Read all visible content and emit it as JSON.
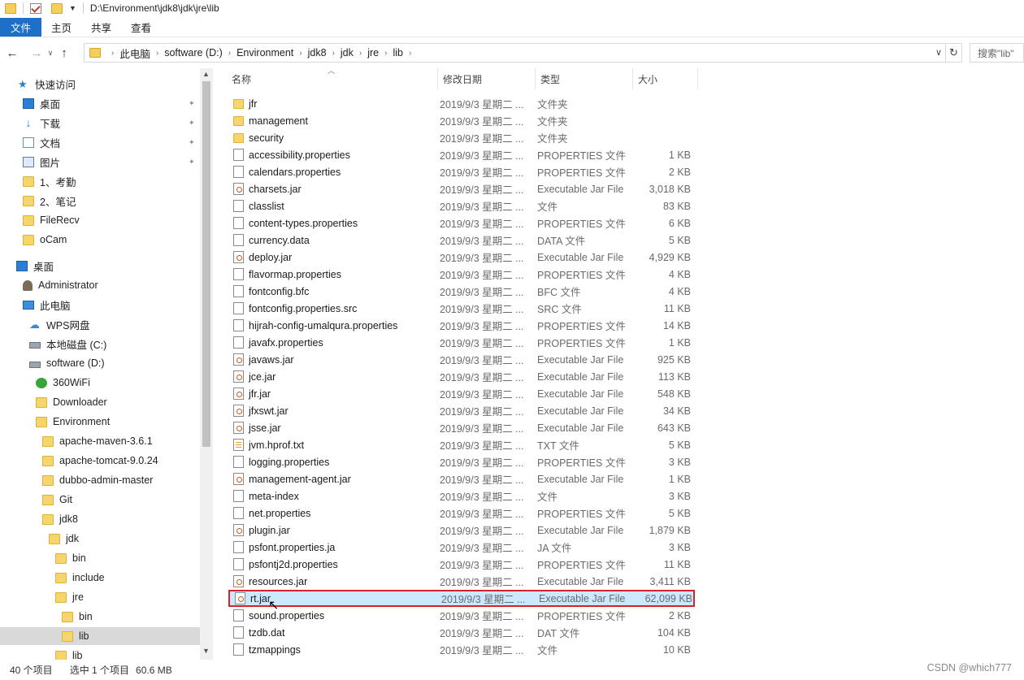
{
  "window": {
    "title": "D:\\Environment\\jdk8\\jdk\\jre\\lib"
  },
  "ribbon": {
    "tabs": [
      "文件",
      "主页",
      "共享",
      "查看"
    ]
  },
  "address": {
    "crumbs": [
      "此电脑",
      "software (D:)",
      "Environment",
      "jdk8",
      "jdk",
      "jre",
      "lib"
    ],
    "search_placeholder": "搜索\"lib\""
  },
  "nav": {
    "items": [
      {
        "label": "快速访问",
        "icon": "star-icon"
      },
      {
        "label": "桌面",
        "icon": "desktop-icon",
        "pinned": true
      },
      {
        "label": "下载",
        "icon": "download-icon",
        "pinned": true
      },
      {
        "label": "文档",
        "icon": "document-icon",
        "pinned": true
      },
      {
        "label": "图片",
        "icon": "picture-icon",
        "pinned": true
      },
      {
        "label": "1、考勤",
        "icon": "folder-icon"
      },
      {
        "label": "2、笔记",
        "icon": "folder-icon"
      },
      {
        "label": "FileRecv",
        "icon": "folder-icon"
      },
      {
        "label": "oCam",
        "icon": "folder-icon"
      },
      {
        "label": "桌面",
        "icon": "desktop-icon"
      },
      {
        "label": "Administrator",
        "icon": "user-icon"
      },
      {
        "label": "此电脑",
        "icon": "computer-icon"
      },
      {
        "label": "WPS网盘",
        "icon": "cloud-icon"
      },
      {
        "label": "本地磁盘 (C:)",
        "icon": "drive-icon"
      },
      {
        "label": "software (D:)",
        "icon": "drive-icon"
      },
      {
        "label": "360WiFi",
        "icon": "wifi-icon"
      },
      {
        "label": "Downloader",
        "icon": "folder-icon"
      },
      {
        "label": "Environment",
        "icon": "folder-icon"
      },
      {
        "label": "apache-maven-3.6.1",
        "icon": "folder-icon"
      },
      {
        "label": "apache-tomcat-9.0.24",
        "icon": "folder-icon"
      },
      {
        "label": "dubbo-admin-master",
        "icon": "folder-icon"
      },
      {
        "label": "Git",
        "icon": "folder-icon"
      },
      {
        "label": "jdk8",
        "icon": "folder-icon"
      },
      {
        "label": "jdk",
        "icon": "folder-icon"
      },
      {
        "label": "bin",
        "icon": "folder-icon"
      },
      {
        "label": "include",
        "icon": "folder-icon"
      },
      {
        "label": "jre",
        "icon": "folder-icon"
      },
      {
        "label": "bin",
        "icon": "folder-icon"
      },
      {
        "label": "lib",
        "icon": "folder-icon",
        "selected": true
      },
      {
        "label": "lib",
        "icon": "folder-icon"
      }
    ]
  },
  "columns": {
    "name": "名称",
    "date": "修改日期",
    "type": "类型",
    "size": "大小"
  },
  "files": [
    {
      "name": "jfr",
      "date": "2019/9/3 星期二 ...",
      "type": "文件夹",
      "size": "",
      "icon": "folder"
    },
    {
      "name": "management",
      "date": "2019/9/3 星期二 ...",
      "type": "文件夹",
      "size": "",
      "icon": "folder"
    },
    {
      "name": "security",
      "date": "2019/9/3 星期二 ...",
      "type": "文件夹",
      "size": "",
      "icon": "folder"
    },
    {
      "name": "accessibility.properties",
      "date": "2019/9/3 星期二 ...",
      "type": "PROPERTIES 文件",
      "size": "1 KB",
      "icon": "file"
    },
    {
      "name": "calendars.properties",
      "date": "2019/9/3 星期二 ...",
      "type": "PROPERTIES 文件",
      "size": "2 KB",
      "icon": "file"
    },
    {
      "name": "charsets.jar",
      "date": "2019/9/3 星期二 ...",
      "type": "Executable Jar File",
      "size": "3,018 KB",
      "icon": "jar"
    },
    {
      "name": "classlist",
      "date": "2019/9/3 星期二 ...",
      "type": "文件",
      "size": "83 KB",
      "icon": "file"
    },
    {
      "name": "content-types.properties",
      "date": "2019/9/3 星期二 ...",
      "type": "PROPERTIES 文件",
      "size": "6 KB",
      "icon": "file"
    },
    {
      "name": "currency.data",
      "date": "2019/9/3 星期二 ...",
      "type": "DATA 文件",
      "size": "5 KB",
      "icon": "file"
    },
    {
      "name": "deploy.jar",
      "date": "2019/9/3 星期二 ...",
      "type": "Executable Jar File",
      "size": "4,929 KB",
      "icon": "jar"
    },
    {
      "name": "flavormap.properties",
      "date": "2019/9/3 星期二 ...",
      "type": "PROPERTIES 文件",
      "size": "4 KB",
      "icon": "file"
    },
    {
      "name": "fontconfig.bfc",
      "date": "2019/9/3 星期二 ...",
      "type": "BFC 文件",
      "size": "4 KB",
      "icon": "file"
    },
    {
      "name": "fontconfig.properties.src",
      "date": "2019/9/3 星期二 ...",
      "type": "SRC 文件",
      "size": "11 KB",
      "icon": "file"
    },
    {
      "name": "hijrah-config-umalqura.properties",
      "date": "2019/9/3 星期二 ...",
      "type": "PROPERTIES 文件",
      "size": "14 KB",
      "icon": "file"
    },
    {
      "name": "javafx.properties",
      "date": "2019/9/3 星期二 ...",
      "type": "PROPERTIES 文件",
      "size": "1 KB",
      "icon": "file"
    },
    {
      "name": "javaws.jar",
      "date": "2019/9/3 星期二 ...",
      "type": "Executable Jar File",
      "size": "925 KB",
      "icon": "jar"
    },
    {
      "name": "jce.jar",
      "date": "2019/9/3 星期二 ...",
      "type": "Executable Jar File",
      "size": "113 KB",
      "icon": "jar"
    },
    {
      "name": "jfr.jar",
      "date": "2019/9/3 星期二 ...",
      "type": "Executable Jar File",
      "size": "548 KB",
      "icon": "jar"
    },
    {
      "name": "jfxswt.jar",
      "date": "2019/9/3 星期二 ...",
      "type": "Executable Jar File",
      "size": "34 KB",
      "icon": "jar"
    },
    {
      "name": "jsse.jar",
      "date": "2019/9/3 星期二 ...",
      "type": "Executable Jar File",
      "size": "643 KB",
      "icon": "jar"
    },
    {
      "name": "jvm.hprof.txt",
      "date": "2019/9/3 星期二 ...",
      "type": "TXT 文件",
      "size": "5 KB",
      "icon": "txt"
    },
    {
      "name": "logging.properties",
      "date": "2019/9/3 星期二 ...",
      "type": "PROPERTIES 文件",
      "size": "3 KB",
      "icon": "file"
    },
    {
      "name": "management-agent.jar",
      "date": "2019/9/3 星期二 ...",
      "type": "Executable Jar File",
      "size": "1 KB",
      "icon": "jar"
    },
    {
      "name": "meta-index",
      "date": "2019/9/3 星期二 ...",
      "type": "文件",
      "size": "3 KB",
      "icon": "file"
    },
    {
      "name": "net.properties",
      "date": "2019/9/3 星期二 ...",
      "type": "PROPERTIES 文件",
      "size": "5 KB",
      "icon": "file"
    },
    {
      "name": "plugin.jar",
      "date": "2019/9/3 星期二 ...",
      "type": "Executable Jar File",
      "size": "1,879 KB",
      "icon": "jar"
    },
    {
      "name": "psfont.properties.ja",
      "date": "2019/9/3 星期二 ...",
      "type": "JA 文件",
      "size": "3 KB",
      "icon": "file"
    },
    {
      "name": "psfontj2d.properties",
      "date": "2019/9/3 星期二 ...",
      "type": "PROPERTIES 文件",
      "size": "11 KB",
      "icon": "file"
    },
    {
      "name": "resources.jar",
      "date": "2019/9/3 星期二 ...",
      "type": "Executable Jar File",
      "size": "3,411 KB",
      "icon": "jar"
    },
    {
      "name": "rt.jar",
      "date": "2019/9/3 星期二 ...",
      "type": "Executable Jar File",
      "size": "62,099 KB",
      "icon": "jar",
      "selected": true
    },
    {
      "name": "sound.properties",
      "date": "2019/9/3 星期二 ...",
      "type": "PROPERTIES 文件",
      "size": "2 KB",
      "icon": "file"
    },
    {
      "name": "tzdb.dat",
      "date": "2019/9/3 星期二 ...",
      "type": "DAT 文件",
      "size": "104 KB",
      "icon": "file"
    },
    {
      "name": "tzmappings",
      "date": "2019/9/3 星期二 ...",
      "type": "文件",
      "size": "10 KB",
      "icon": "file"
    }
  ],
  "status": {
    "count": "40 个项目",
    "selected": "选中 1 个项目",
    "size": "60.6 MB"
  },
  "watermark": "CSDN @which777"
}
